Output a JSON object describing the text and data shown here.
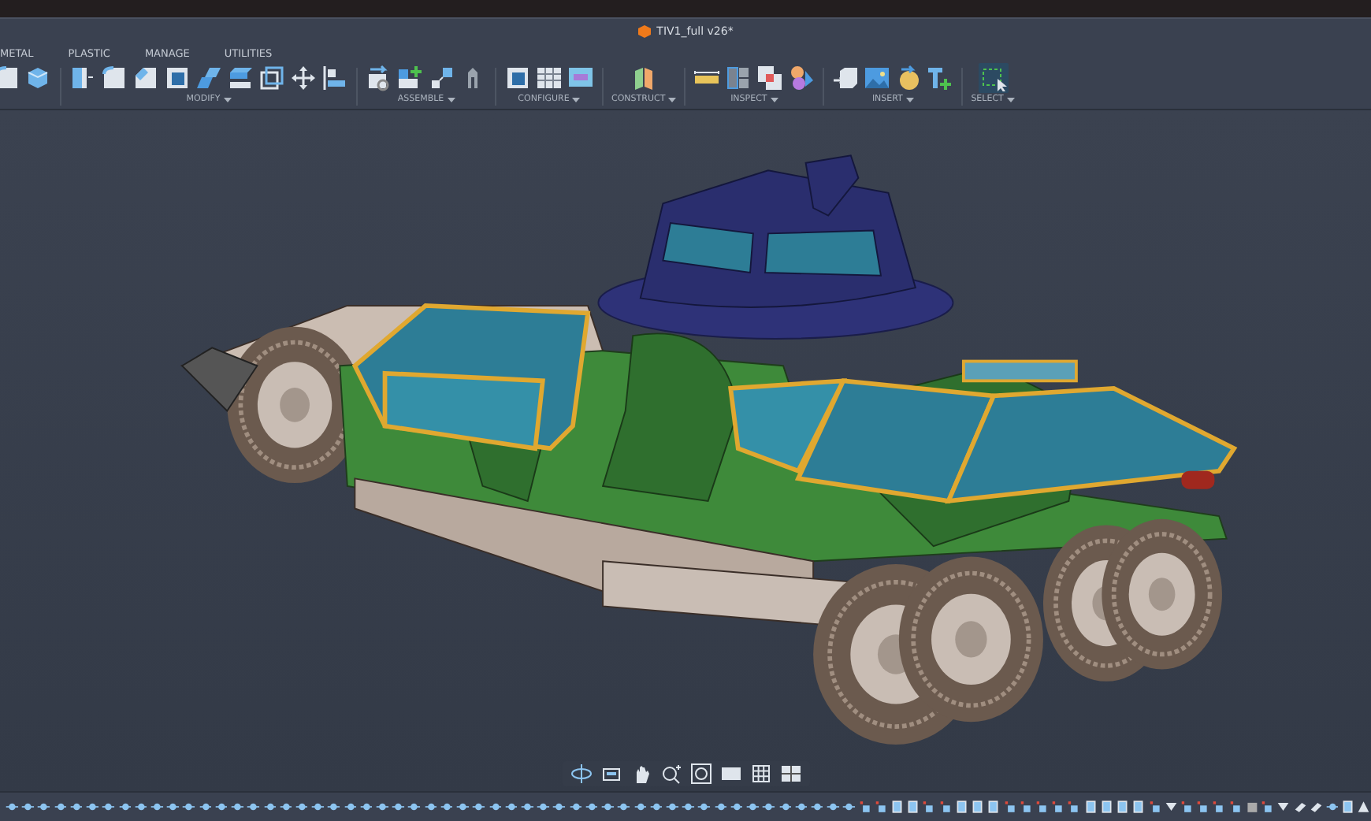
{
  "window": {
    "title": "TIV1_full v26*"
  },
  "tabs": [
    {
      "label": "METAL",
      "selected": false
    },
    {
      "label": "PLASTIC",
      "selected": false
    },
    {
      "label": "MANAGE",
      "selected": false
    },
    {
      "label": "UTILITIES",
      "selected": false
    }
  ],
  "groups": [
    {
      "label": "MODIFY"
    },
    {
      "label": "ASSEMBLE"
    },
    {
      "label": "CONFIGURE"
    },
    {
      "label": "CONSTRUCT"
    },
    {
      "label": "INSPECT"
    },
    {
      "label": "INSERT"
    },
    {
      "label": "SELECT"
    }
  ]
}
